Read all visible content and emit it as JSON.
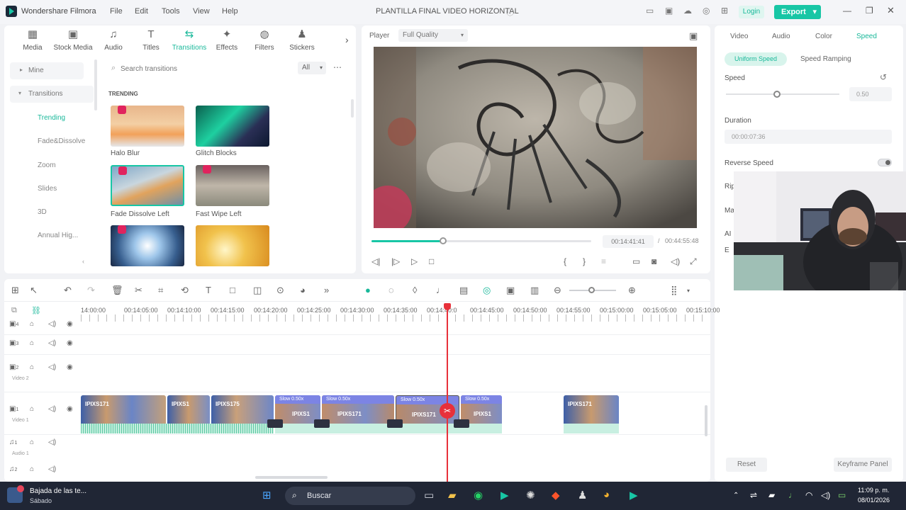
{
  "titlebar": {
    "app_name": "Wondershare Filmora",
    "menu": [
      "File",
      "Edit",
      "Tools",
      "View",
      "Help"
    ],
    "doc_title": "PLANTILLA FINAL VIDEO HORIZONTAL",
    "login": "Login",
    "export": "Export"
  },
  "toolbar": {
    "tools": [
      "Media",
      "Stock Media",
      "Audio",
      "Titles",
      "Transitions",
      "Effects",
      "Filters",
      "Stickers"
    ],
    "active": "Transitions"
  },
  "sidebar": {
    "items": [
      "Mine",
      "Transitions",
      "Trending",
      "Fade&Dissolve",
      "Zoom",
      "Slides",
      "3D",
      "Annual Hig..."
    ]
  },
  "library": {
    "search_placeholder": "Search transitions",
    "filter": "All",
    "section": "TRENDING",
    "thumbs": [
      "Halo Blur",
      "Glitch Blocks",
      "Fade Dissolve Left",
      "Fast Wipe Left",
      "",
      ""
    ]
  },
  "player": {
    "label": "Player",
    "quality": "Full Quality",
    "current_time": "00:14:41:41",
    "separator": "/",
    "total_time": "00:44:55:48",
    "progress": 0.33
  },
  "right_panel": {
    "tabs": [
      "Video",
      "Audio",
      "Color",
      "Speed"
    ],
    "active_tab": "Speed",
    "mode_tabs": [
      "Uniform Speed",
      "Speed Ramping"
    ],
    "speed_label": "Speed",
    "speed_value": "0.50",
    "duration_label": "Duration",
    "duration_value": "00:00:07:36",
    "reverse_label": "Reverse Speed",
    "partial_labels": [
      "Rip",
      "Ma",
      "AI",
      "E"
    ],
    "reset": "Reset",
    "keyframe": "Keyframe Panel"
  },
  "timeline": {
    "ruler": [
      "14:00:00",
      "00:14:05:00",
      "00:14:10:00",
      "00:14:15:00",
      "00:14:20:00",
      "00:14:25:00",
      "00:14:30:00",
      "00:14:35:00",
      "00:14:40:0",
      "00:14:45:00",
      "00:14:50:00",
      "00:14:55:00",
      "00:15:00:00",
      "00:15:05:00",
      "00:15:10:00"
    ],
    "tracks": {
      "video2": "Video 2",
      "video1": "Video 1",
      "audio1": "Audio 1"
    },
    "track_numbers": [
      "4",
      "3",
      "2",
      "1",
      "1",
      "2"
    ],
    "clips": [
      "IPIXS171",
      "IPIXS1",
      "IPIXS175",
      "IPIXS1",
      "IPIXS171",
      "IPIXS171",
      "IPIXS1",
      "IPIXS171"
    ],
    "clip_tags": [
      "Slow 0.50x",
      "Slow 0.50x",
      "Slow 0.50x",
      "Slow 0.50x"
    ]
  },
  "taskbar": {
    "notification_title": "Bajada de las te...",
    "notification_sub": "Sábado",
    "search": "Buscar",
    "time": "11:09 p. m.",
    "date": "08/01/2026"
  },
  "colors": {
    "accent": "#18c6a5",
    "playhead": "#e8303a",
    "clip": "#7c84e4"
  }
}
